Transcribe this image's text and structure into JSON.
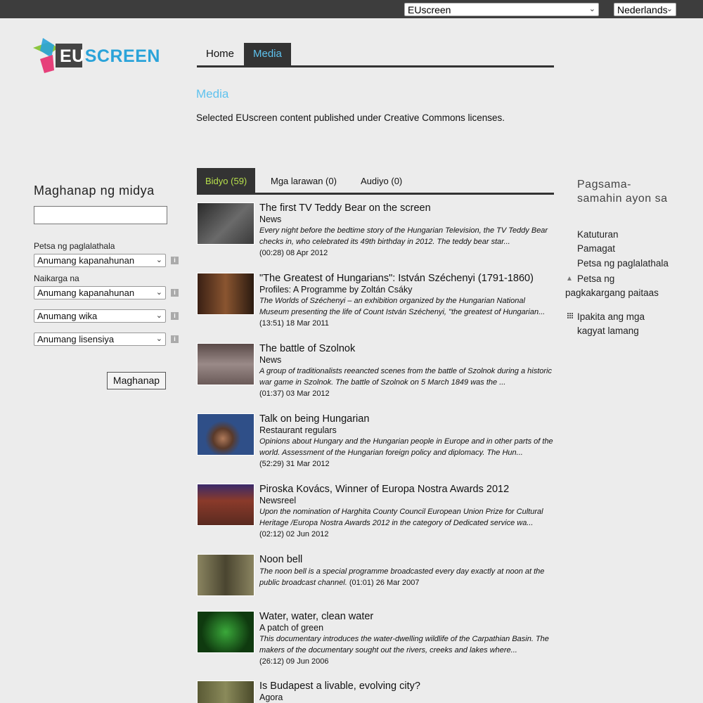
{
  "topbar": {
    "site_select": "EUscreen",
    "language_select": "Nederlands"
  },
  "logo": {
    "part1": "EU",
    "part2": "SCREEN"
  },
  "nav": {
    "home": "Home",
    "media": "Media"
  },
  "page": {
    "title": "Media",
    "description": "Selected EUscreen content published under Creative Commons licenses."
  },
  "search": {
    "heading": "Maghanap ng midya",
    "input_value": "",
    "published_label": "Petsa ng paglalathala",
    "published_value": "Anumang kapanahunan",
    "uploaded_label": "Naikarga na",
    "uploaded_value": "Anumang kapanahunan",
    "language_value": "Anumang wika",
    "license_value": "Anumang lisensiya",
    "button": "Maghanap",
    "info_glyph": "i"
  },
  "tabs": {
    "video": "Bidyo (59)",
    "images": "Mga larawan (0)",
    "audio": "Audiyo (0)"
  },
  "results": [
    {
      "title": "The first TV Teddy Bear on the screen",
      "subtitle": "News",
      "desc": "Every night before the bedtime story of the Hungarian Television, the TV Teddy Bear checks in, who celebrated its 49th birthday in 2012. The teddy bear star...",
      "meta": "(00:28) 08 Apr 2012",
      "thumb_color": "#4a4a4a"
    },
    {
      "title": "\"The Greatest of Hungarians\": István Széchenyi (1791-1860)",
      "subtitle": "Profiles: A Programme by Zoltán Csáky",
      "desc": "The Worlds of Széchenyi – an exhibition organized by the Hungarian National Museum presenting the life of Count István Széchenyi, \"the greatest of Hungarian...",
      "meta": "(13:51) 18 Mar 2011",
      "thumb_color": "#6b3a22"
    },
    {
      "title": "The battle of Szolnok",
      "subtitle": "News",
      "desc": "A group of traditionalists reeancted scenes from the battle of Szolnok during a historic war game in Szolnok. The battle of Szolnok on 5 March 1849 was the ...",
      "meta": "(01:37) 03 Mar 2012",
      "thumb_color": "#7a5a55"
    },
    {
      "title": "Talk on being Hungarian",
      "subtitle": "Restaurant regulars",
      "desc": "Opinions about Hungary and the Hungarian people in Europe and in other parts of the world. Assessment of the Hungarian foreign policy and diplomacy. The Hun...",
      "meta": "(52:29) 31 Mar 2012",
      "thumb_color": "#2f4f88"
    },
    {
      "title": "Piroska Kovács, Winner of Europa Nostra Awards 2012",
      "subtitle": "Newsreel",
      "desc": "Upon the nomination of Harghita County Council European Union Prize for Cultural Heritage /Europa Nostra Awards 2012 in the category of Dedicated service wa...",
      "meta": "(02:12) 02 Jun 2012",
      "thumb_color": "#7a2a25"
    },
    {
      "title": "Noon bell",
      "subtitle": "",
      "desc": "The noon bell is a special programme broadcasted every day exactly at noon at the public broadcast channel.",
      "meta": "(01:01) 26 Mar 2007",
      "thumb_color": "#6f6a55"
    },
    {
      "title": "Water, water, clean water",
      "subtitle": "A patch of green",
      "desc": "This documentary introduces the water-dwelling wildlife of the Carpathian Basin. The makers of the documentary sought out the rivers, creeks and lakes where...",
      "meta": "(26:12) 09 Jun 2006",
      "thumb_color": "#1d5a1d"
    },
    {
      "title": "Is Budapest a livable, evolving city?",
      "subtitle": "Agora",
      "desc": "",
      "meta": "",
      "thumb_color": "#6a6a45"
    }
  ],
  "sort": {
    "heading": "Pagsama-samahin ayon sa",
    "relevance": "Katuturan",
    "title": "Pamagat",
    "pubdate": "Petsa ng paglalathala",
    "uploaddate": "Petsa ng pagkakargang paitaas",
    "show_instant": "Ipakita ang mga kagyat lamang"
  }
}
